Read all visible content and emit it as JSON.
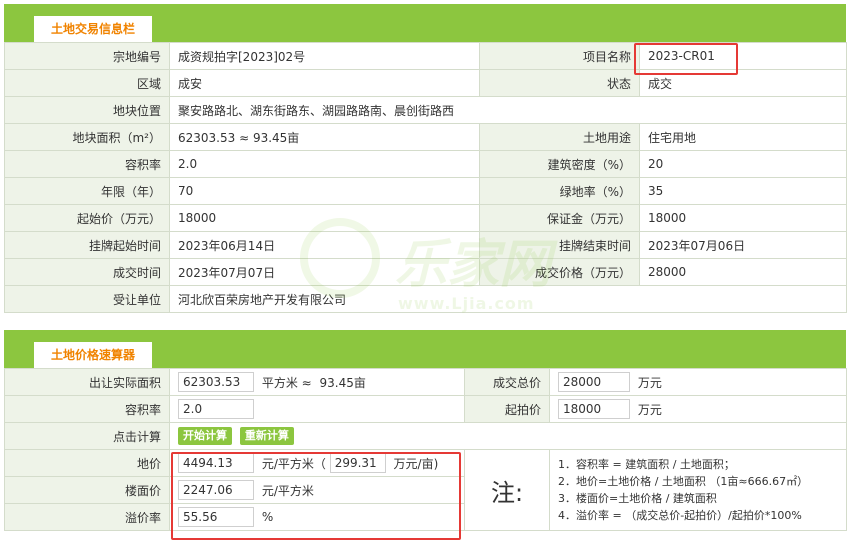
{
  "section1": {
    "title": "土地交易信息栏",
    "rows": [
      {
        "l1": "宗地编号",
        "v1": "成资规拍字[2023]02号",
        "l2": "项目名称",
        "v2": "2023-CR01"
      },
      {
        "l1": "区域",
        "v1": "成安",
        "l2": "状态",
        "v2": "成交"
      },
      {
        "l1": "地块位置",
        "v1": "聚安路路北、湖东街路东、湖园路路南、晨创街路西",
        "l2": "",
        "v2": ""
      },
      {
        "l1": "地块面积（m²）",
        "v1": "62303.53 ≈ 93.45亩",
        "l2": "土地用途",
        "v2": "住宅用地"
      },
      {
        "l1": "容积率",
        "v1": "2.0",
        "l2": "建筑密度（%）",
        "v2": "20"
      },
      {
        "l1": "年限（年）",
        "v1": "70",
        "l2": "绿地率（%）",
        "v2": "35"
      },
      {
        "l1": "起始价（万元）",
        "v1": "18000",
        "l2": "保证金（万元）",
        "v2": "18000"
      },
      {
        "l1": "挂牌起始时间",
        "v1": "2023年06月14日",
        "l2": "挂牌结束时间",
        "v2": "2023年07月06日"
      },
      {
        "l1": "成交时间",
        "v1": "2023年07月07日",
        "l2": "成交价格（万元）",
        "v2": "28000"
      },
      {
        "l1": "受让单位",
        "v1": "河北欣百荣房地产开发有限公司",
        "l2": "",
        "v2": ""
      }
    ]
  },
  "watermark": {
    "text": "乐家网",
    "url": "www.Ljia.com"
  },
  "section2": {
    "title": "土地价格速算器",
    "area_label": "出让实际面积",
    "area_value": "62303.53",
    "area_unit": "平方米 ≈",
    "area_mu": "93.45亩",
    "total_label": "成交总价",
    "total_value": "28000",
    "total_unit": "万元",
    "far_label": "容积率",
    "far_value": "2.0",
    "start_label": "起拍价",
    "start_value": "18000",
    "start_unit": "万元",
    "calc_label": "点击计算",
    "btn_start": "开始计算",
    "btn_reset": "重新计算",
    "land_price_label": "地价",
    "land_price_value": "4494.13",
    "land_price_unit": "元/平方米（",
    "land_price_mu_value": "299.31",
    "land_price_mu_unit": "万元/亩)",
    "floor_price_label": "楼面价",
    "floor_price_value": "2247.06",
    "floor_price_unit": "元/平方米",
    "premium_label": "溢价率",
    "premium_value": "55.56",
    "premium_unit": "%",
    "note_title": "注:",
    "notes": [
      "1．容积率 = 建筑面积 / 土地面积；",
      "2．地价=土地价格 / 土地面积 （1亩≈666.67㎡）",
      "3．楼面价=土地价格 / 建筑面积",
      "4．溢价率 = （成交总价-起拍价）/起拍价*100%"
    ]
  },
  "colors": {
    "accent": "#8cc63f",
    "tab_text": "#f08300",
    "label_bg": "#eef3e8",
    "highlight": "#e53935"
  }
}
